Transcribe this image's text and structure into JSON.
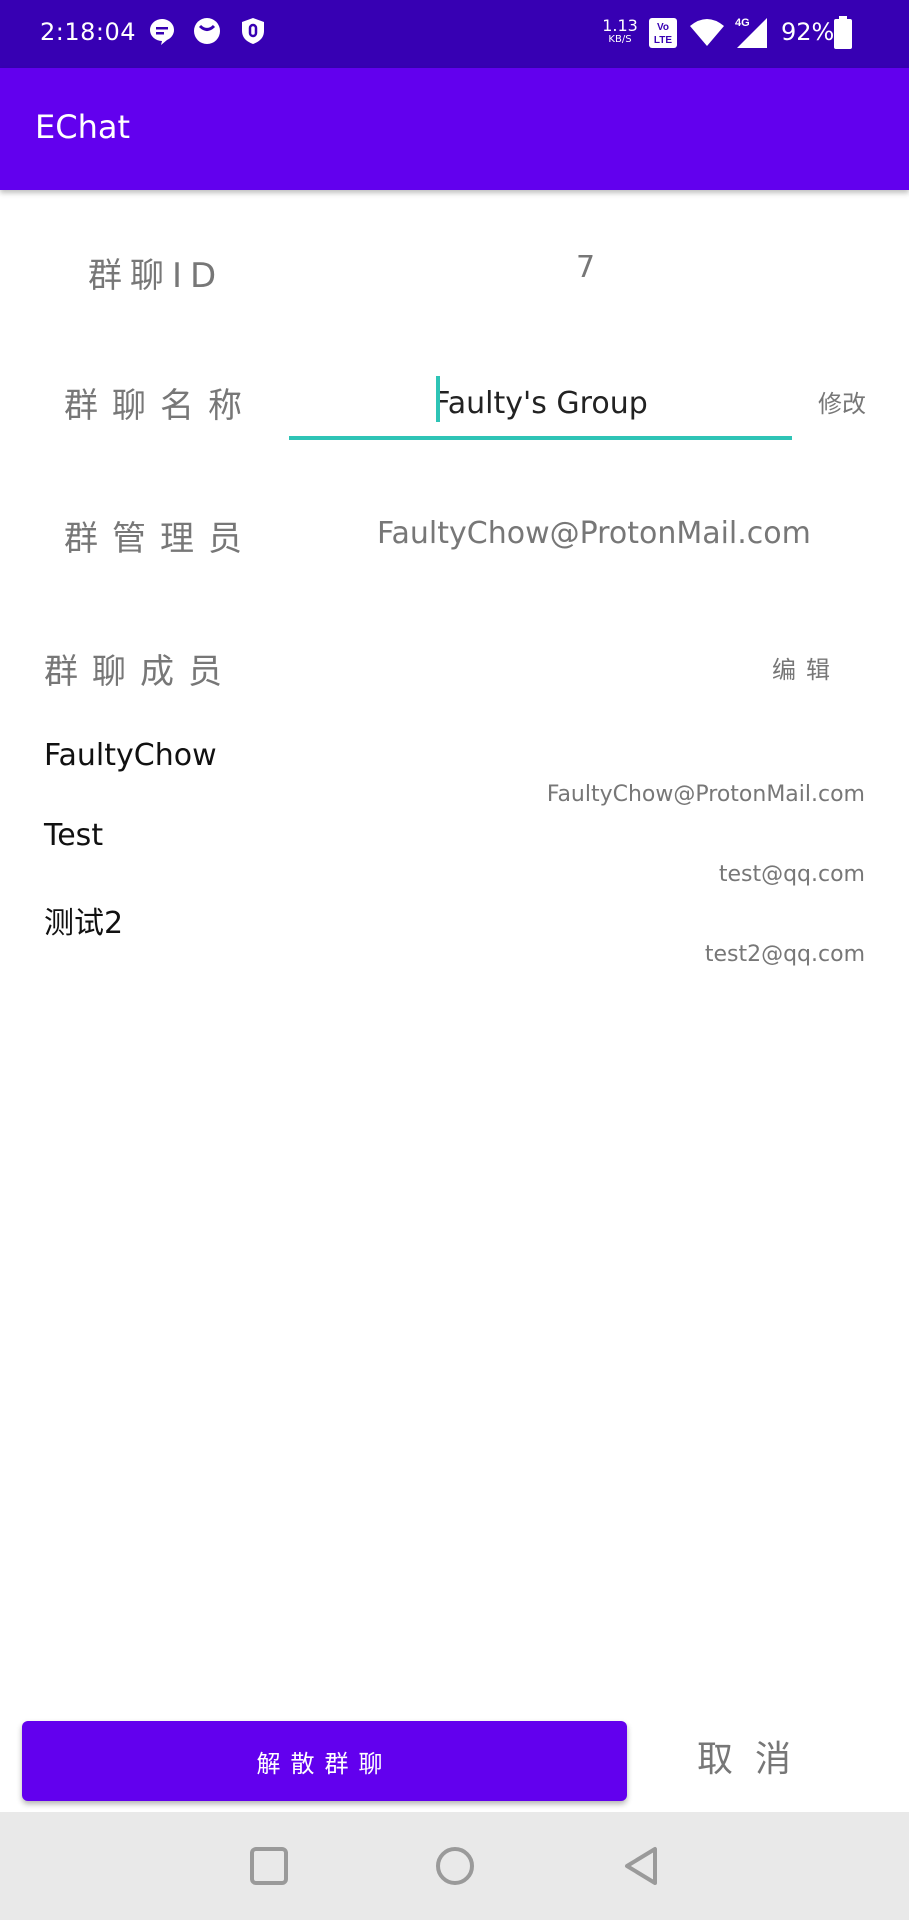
{
  "status_bar": {
    "time": "2:18:04",
    "net_speed": "1.13",
    "net_speed_unit": "KB/S",
    "volte_label": "Vo LTE",
    "network": "4G",
    "battery": "92%",
    "icons": [
      "chat-bubble-icon",
      "face-icon",
      "shield-icon",
      "volte-icon",
      "wifi-icon",
      "signal-icon",
      "battery-icon"
    ]
  },
  "app_bar": {
    "title": "EChat"
  },
  "group": {
    "id_label": "群聊ID",
    "id_value": "7",
    "name_label": "群聊名称",
    "name_value": "Faulty's Group",
    "rename_label": "修改",
    "admin_label": "群管理员",
    "admin_value": "FaultyChow@ProtonMail.com",
    "members_label": "群聊成员",
    "edit_label": "编辑"
  },
  "members": [
    {
      "name": "FaultyChow",
      "email": "FaultyChow@ProtonMail.com"
    },
    {
      "name": "Test",
      "email": "test@qq.com"
    },
    {
      "name": "测试2",
      "email": "test2@qq.com"
    }
  ],
  "actions": {
    "dissolve_label": "解散群聊",
    "cancel_label": "取消"
  },
  "nav_bar": {
    "icons": [
      "recents-square-icon",
      "home-circle-icon",
      "back-triangle-icon"
    ]
  },
  "colors": {
    "status_bar": "#3700b3",
    "app_bar": "#6200ee",
    "accent": "#2ec4b6",
    "primary_button": "#6200ee"
  }
}
